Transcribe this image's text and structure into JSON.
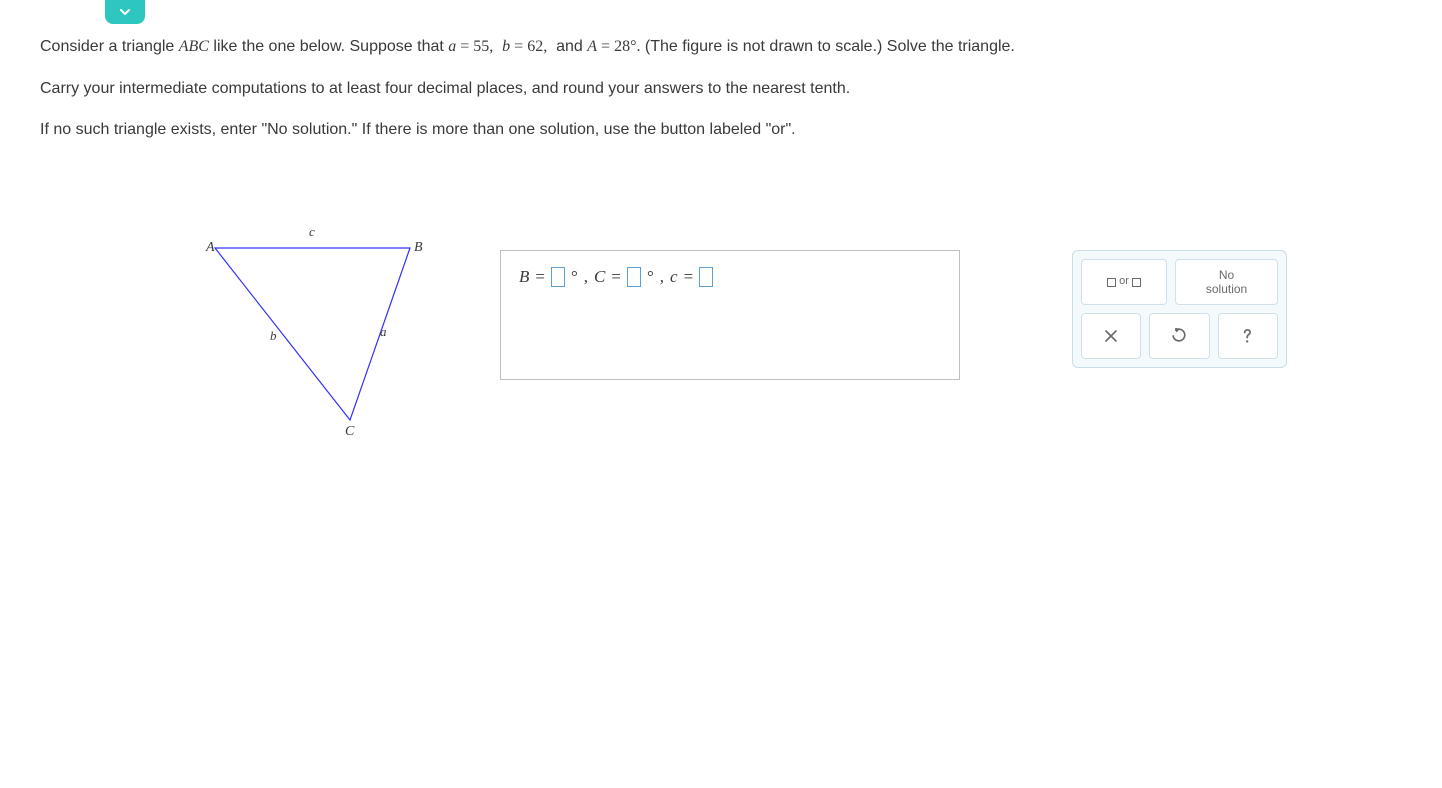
{
  "problem": {
    "line1_pre": "Consider a triangle ",
    "line1_tri": "ABC",
    "line1_mid": " like the one below. Suppose that ",
    "given_a_var": "a",
    "eq": " = ",
    "given_a_val": "55,",
    "given_b_var": "b",
    "given_b_val": "62,",
    "and": " and ",
    "given_A_var": "A",
    "given_A_val": "28°.",
    "line1_post": " (The figure is not drawn to scale.) Solve the triangle.",
    "line2": "Carry your intermediate computations to at least four decimal places, and round your answers to the nearest tenth.",
    "line3": "If no such triangle exists, enter \"No solution.\" If there is more than one solution, use the button labeled \"or\"."
  },
  "figure": {
    "v_A": "A",
    "v_B": "B",
    "v_C": "C",
    "s_a": "a",
    "s_b": "b",
    "s_c": "c"
  },
  "answer": {
    "B_label": "B",
    "C_label": "C",
    "c_label": "c",
    "eq": " = ",
    "deg": "°",
    "comma": ", "
  },
  "tools": {
    "or_label": "or",
    "no_solution": "No\nsolution"
  }
}
